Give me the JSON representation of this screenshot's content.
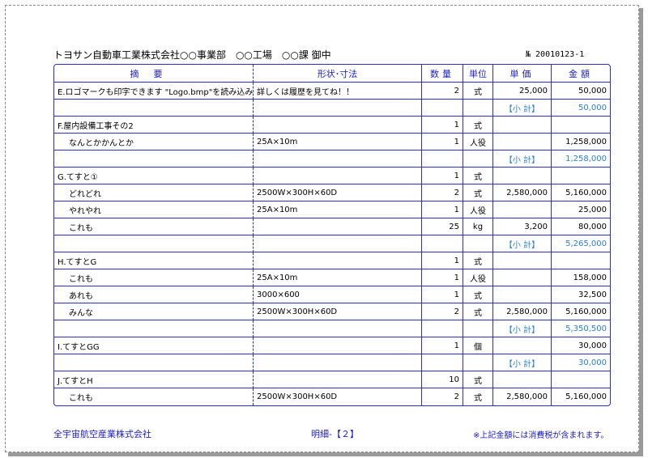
{
  "header": {
    "recipient": "トヨサン自動車工業株式会社○○事業部　○○工場　○○課 御中",
    "doc_number": "№ 20010123-1"
  },
  "table": {
    "headers": {
      "description": "摘要",
      "spec": "形状･寸法",
      "qty": "数量",
      "unit": "単位",
      "price": "単価",
      "amount": "金額"
    },
    "rows": [
      {
        "desc": "E.ロゴマークも印字できます \"Logo.bmp\"を読み込みます。",
        "spec": "詳しくは履歴を見てね！！",
        "qty": "2",
        "unit": "式",
        "price": "25,000",
        "amount": "50,000",
        "indent": false,
        "subtotal": false
      },
      {
        "desc": "",
        "spec": "",
        "qty": "",
        "unit": "",
        "price": "【小 計】",
        "amount": "50,000",
        "indent": false,
        "subtotal": true
      },
      {
        "desc": "F.屋内設備工事その2",
        "spec": "",
        "qty": "1",
        "unit": "式",
        "price": "",
        "amount": "",
        "indent": false,
        "subtotal": false
      },
      {
        "desc": "なんとかかんとか",
        "spec": "25A×10m",
        "qty": "1",
        "unit": "人役",
        "price": "",
        "amount": "1,258,000",
        "indent": true,
        "subtotal": false
      },
      {
        "desc": "",
        "spec": "",
        "qty": "",
        "unit": "",
        "price": "【小 計】",
        "amount": "1,258,000",
        "indent": false,
        "subtotal": true
      },
      {
        "desc": "G.てすと①",
        "spec": "",
        "qty": "1",
        "unit": "式",
        "price": "",
        "amount": "",
        "indent": false,
        "subtotal": false
      },
      {
        "desc": "どれどれ",
        "spec": "2500W×300H×60D",
        "qty": "2",
        "unit": "式",
        "price": "2,580,000",
        "amount": "5,160,000",
        "indent": true,
        "subtotal": false
      },
      {
        "desc": "やれやれ",
        "spec": "25A×10m",
        "qty": "1",
        "unit": "人役",
        "price": "",
        "amount": "25,000",
        "indent": true,
        "subtotal": false
      },
      {
        "desc": "これも",
        "spec": "",
        "qty": "25",
        "unit": "kg",
        "price": "3,200",
        "amount": "80,000",
        "indent": true,
        "subtotal": false
      },
      {
        "desc": "",
        "spec": "",
        "qty": "",
        "unit": "",
        "price": "【小 計】",
        "amount": "5,265,000",
        "indent": false,
        "subtotal": true
      },
      {
        "desc": "H.てすとG",
        "spec": "",
        "qty": "1",
        "unit": "式",
        "price": "",
        "amount": "",
        "indent": false,
        "subtotal": false
      },
      {
        "desc": "これも",
        "spec": "25A×10m",
        "qty": "1",
        "unit": "人役",
        "price": "",
        "amount": "158,000",
        "indent": true,
        "subtotal": false
      },
      {
        "desc": "あれも",
        "spec": "3000×600",
        "qty": "1",
        "unit": "式",
        "price": "",
        "amount": "32,500",
        "indent": true,
        "subtotal": false
      },
      {
        "desc": "みんな",
        "spec": "2500W×300H×60D",
        "qty": "2",
        "unit": "式",
        "price": "2,580,000",
        "amount": "5,160,000",
        "indent": true,
        "subtotal": false
      },
      {
        "desc": "",
        "spec": "",
        "qty": "",
        "unit": "",
        "price": "【小 計】",
        "amount": "5,350,500",
        "indent": false,
        "subtotal": true
      },
      {
        "desc": "I.てすとGG",
        "spec": "",
        "qty": "1",
        "unit": "個",
        "price": "",
        "amount": "30,000",
        "indent": false,
        "subtotal": false
      },
      {
        "desc": "",
        "spec": "",
        "qty": "",
        "unit": "",
        "price": "【小 計】",
        "amount": "30,000",
        "indent": false,
        "subtotal": true
      },
      {
        "desc": "J.てすとH",
        "spec": "",
        "qty": "10",
        "unit": "式",
        "price": "",
        "amount": "",
        "indent": false,
        "subtotal": false
      },
      {
        "desc": "これも",
        "spec": "2500W×300H×60D",
        "qty": "2",
        "unit": "式",
        "price": "2,580,000",
        "amount": "5,160,000",
        "indent": true,
        "subtotal": false
      }
    ]
  },
  "footer": {
    "company": "全宇宙航空産業株式会社",
    "page": "明細-【２】",
    "note": "※上記金額には消費税が含まれます。"
  },
  "colors": {
    "rule": "#2e2ec6",
    "header_text": "#2020c0",
    "subtotal_text": "#2a7fd4"
  }
}
